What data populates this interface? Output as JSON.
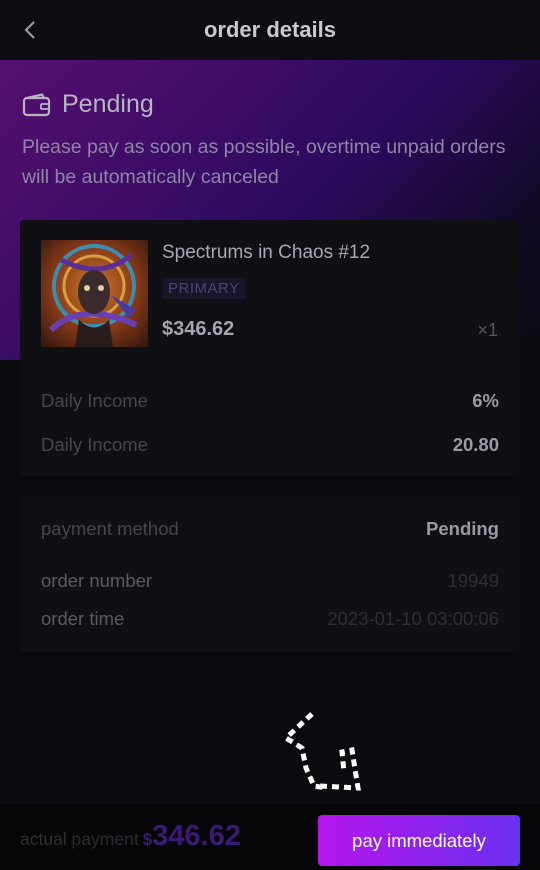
{
  "header": {
    "title": "order details"
  },
  "status": {
    "label": "Pending",
    "notice": "Please pay as soon as possible, overtime unpaid orders will be automatically canceled"
  },
  "product": {
    "name": "Spectrums in Chaos #12",
    "tag": "PRIMARY",
    "price": "$346.62",
    "qty": "×1"
  },
  "income": [
    {
      "label": "Daily Income",
      "value": "6%"
    },
    {
      "label": "Daily Income",
      "value": "20.80"
    }
  ],
  "order": {
    "payment_method_label": "payment method",
    "payment_method_value": "Pending",
    "number_label": "order number",
    "number_value": "19949",
    "time_label": "order time",
    "time_value": "2023-01-10 03:00:06"
  },
  "footer": {
    "actual_label": "actual payment",
    "currency": "$",
    "amount": "346.62",
    "pay_button": "pay immediately"
  },
  "colors": {
    "accent": "#b515ec",
    "accent_end": "#6b2ff0",
    "background": "#0b0b0f"
  }
}
